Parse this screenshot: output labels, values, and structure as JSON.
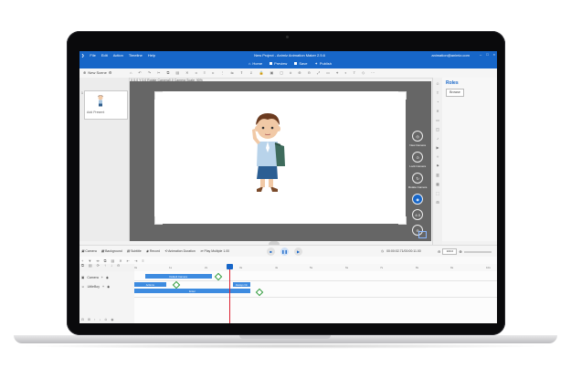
{
  "window": {
    "title": "New Project - Animiz Animation Maker 2.5.6",
    "menu": [
      "File",
      "Edit",
      "Action",
      "Timeline",
      "Help"
    ],
    "account_email": "animation@animiz.com",
    "controls": [
      "–",
      "□",
      "×"
    ]
  },
  "nav": {
    "home": "Home",
    "preview": "Preview",
    "save": "Save",
    "publish": "Publish"
  },
  "toolbar": {
    "new_scene": "New Scene",
    "coord_readout": "X 0.0 Y 0.0 Rotate Camera0.0 Camera Scale: 90%"
  },
  "scene_panel": {
    "scene_number": "1",
    "add_present": "Add Present"
  },
  "stage_buttons": [
    {
      "icon": "camera-icon",
      "label": "New Camera"
    },
    {
      "icon": "lock-icon",
      "label": "Lock Camera"
    },
    {
      "icon": "rotate-icon",
      "label": "Rotate Camera"
    },
    {
      "icon": "scale-icon",
      "label": ""
    },
    {
      "icon": "ratio-icon",
      "label": "4:3"
    },
    {
      "icon": "zoom-out-icon",
      "label": ""
    }
  ],
  "right_panel": {
    "title": "Roles",
    "browse": "Browse"
  },
  "timeline": {
    "tabs": [
      "Camera",
      "Background",
      "Subtitle",
      "Record",
      "Animation Duration",
      "Play Multiple 1.00"
    ],
    "time": "00:00:02.71/00:00:11.00",
    "zoom": "100.0",
    "ruler_ticks": [
      "0s",
      "1s",
      "2s",
      "3s",
      "4s",
      "5s",
      "6s",
      "7s",
      "8s",
      "9s",
      "10s"
    ],
    "tracks": [
      {
        "name": "Camera",
        "clips": [
          {
            "label": "Default Camera",
            "start": 0.3,
            "end": 2.2
          }
        ]
      },
      {
        "name": "LittleBoy",
        "clips": [
          {
            "label": "Actions",
            "start": 0.0,
            "end": 0.9
          },
          {
            "label": "Always On",
            "start": 2.8,
            "end": 3.3
          },
          {
            "label": "Enter",
            "start": 0.0,
            "end": 3.3
          }
        ]
      }
    ],
    "playhead_seconds": 2.71,
    "duration_seconds": 11
  },
  "colors": {
    "accent": "#1766c8",
    "clip": "#3d8be0",
    "keyframe": "#2e9a3a",
    "playhead": "#dd2233"
  }
}
